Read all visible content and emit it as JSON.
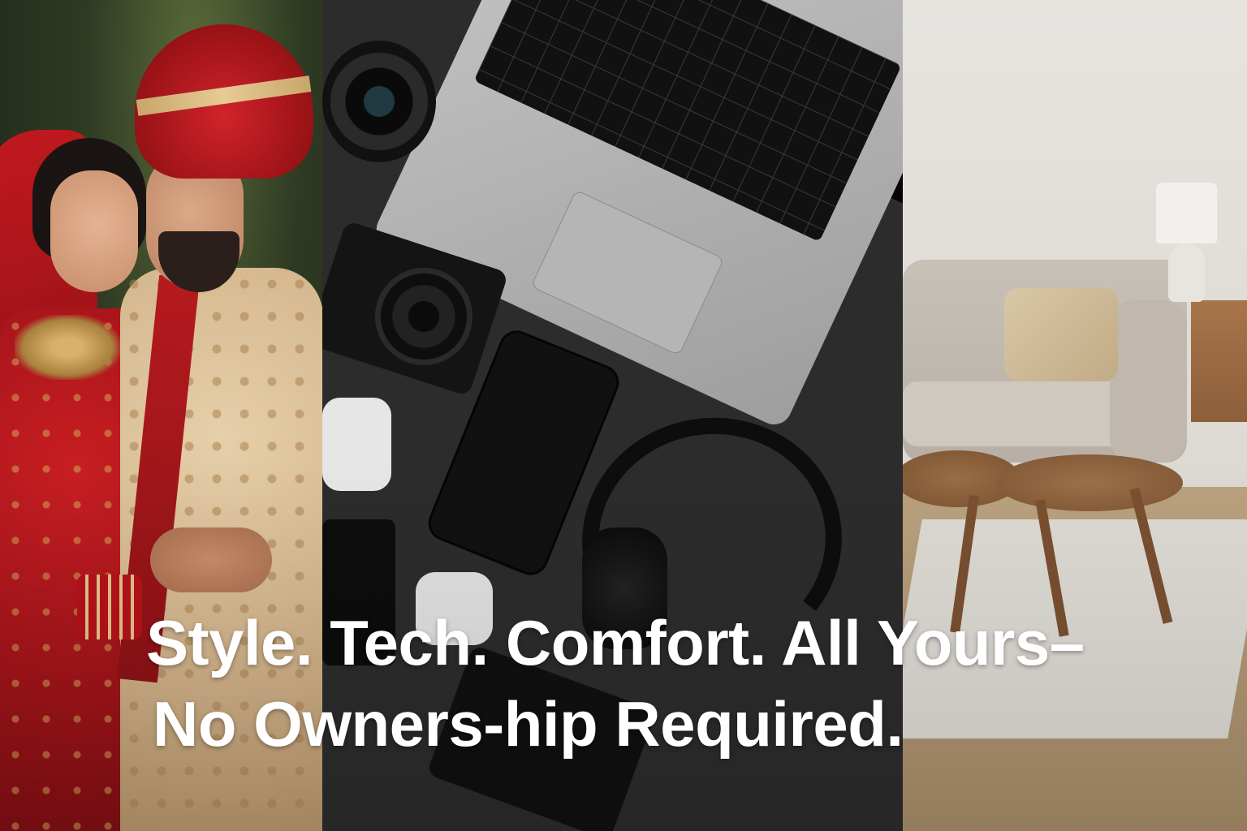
{
  "panels": [
    {
      "subject": "wedding-couple-traditional-attire"
    },
    {
      "subject": "tech-gadgets-flat-lay"
    },
    {
      "subject": "living-room-furniture"
    }
  ],
  "headline": {
    "line1": "Style. Tech. Comfort. All Yours–",
    "line2": "No Owners-hip Required."
  },
  "colors": {
    "headline_text": "#ffffff",
    "bridal_red": "#a3141a",
    "tech_background": "#2c2c2c",
    "room_wall": "#e7e4e0"
  }
}
